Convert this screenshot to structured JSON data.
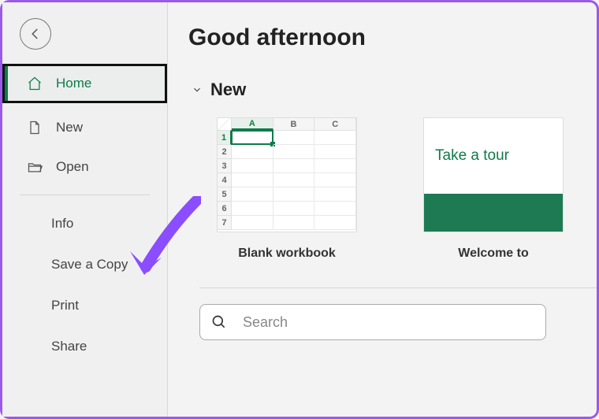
{
  "greeting": "Good afternoon",
  "section_new": "New",
  "sidebar": {
    "home": "Home",
    "new": "New",
    "open": "Open",
    "info": "Info",
    "save_copy": "Save a Copy",
    "print": "Print",
    "share": "Share"
  },
  "templates": {
    "blank": {
      "label": "Blank workbook",
      "cols": [
        "A",
        "B",
        "C"
      ],
      "rows": [
        "1",
        "2",
        "3",
        "4",
        "5",
        "6",
        "7"
      ]
    },
    "tour": {
      "label": "Welcome to",
      "title": "Take a tour"
    }
  },
  "search": {
    "placeholder": "Search"
  },
  "colors": {
    "accent": "#0f7b4b",
    "annotation": "#8a4dff"
  }
}
